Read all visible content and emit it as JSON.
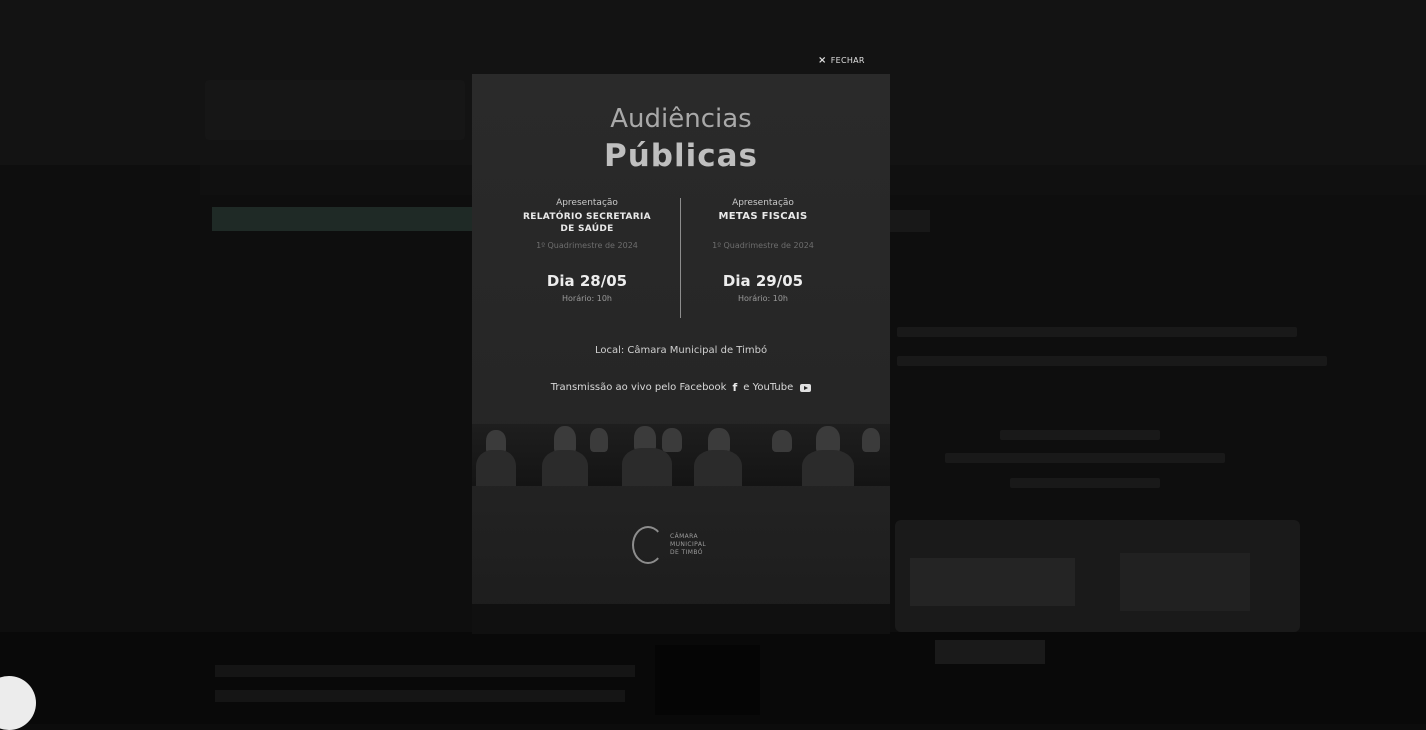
{
  "popup": {
    "close_label": "FECHAR",
    "title_top": "Audiências",
    "title_bottom": "Públicas",
    "left": {
      "pre": "Apresentação",
      "subject_line1": "RELATÓRIO SECRETARIA",
      "subject_line2": "DE SAÚDE",
      "period": "1º Quadrimestre de 2024",
      "day": "Dia 28/05",
      "time": "Horário: 10h"
    },
    "right": {
      "pre": "Apresentação",
      "subject_line1": "METAS FISCAIS",
      "period": "1º Quadrimestre de 2024",
      "day": "Dia 29/05",
      "time": "Horário: 10h"
    },
    "location": "Local: Câmara Municipal de Timbó",
    "transmission_prefix": "Transmissão ao vivo pelo Facebook",
    "transmission_mid": "e YouTube",
    "logo_text_1": "CÂMARA",
    "logo_text_2": "MUNICIPAL",
    "logo_text_3": "DE TIMBÓ"
  },
  "icons": {
    "close": "close-icon",
    "facebook": "facebook-icon",
    "youtube": "youtube-icon"
  },
  "colors": {
    "overlay": "#0c0c0c",
    "modal_bg": "#2a2a2a",
    "title_text": "#bfbfbf"
  }
}
